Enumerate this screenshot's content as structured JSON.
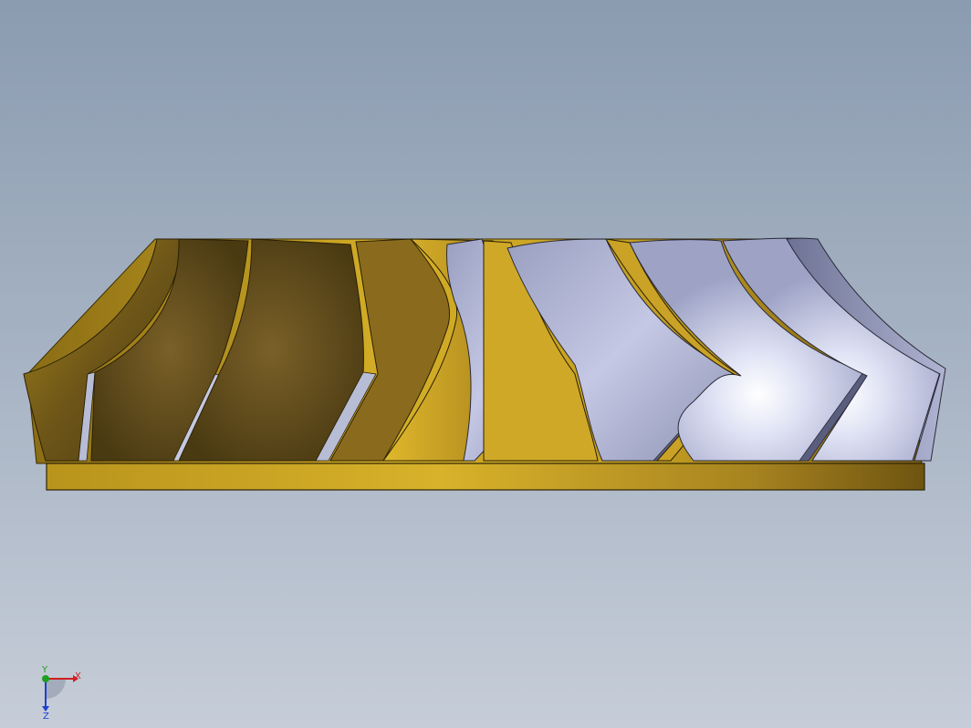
{
  "viewport": {
    "model": "impeller",
    "background_top": "#8b9bb0",
    "background_bottom": "#c6cdd8",
    "gold_color": "#c9a52a",
    "silver_color": "#b8bdd8"
  },
  "triad": {
    "x_label": "X",
    "y_label": "Y",
    "z_label": "Z",
    "x_color": "#d02020",
    "y_color": "#20a020",
    "z_color": "#2040d0"
  }
}
